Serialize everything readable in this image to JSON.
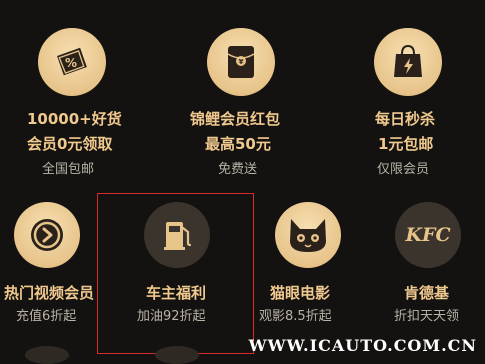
{
  "items": [
    {
      "title": "10000+好货",
      "line2": "会员0元领取",
      "subtitle": "全国包邮",
      "icon": "coupon-icon"
    },
    {
      "title": "锦鲤会员红包",
      "line2": "最高50元",
      "subtitle": "免费送",
      "icon": "red-envelope-icon"
    },
    {
      "title": "每日秒杀",
      "line2": "1元包邮",
      "subtitle": "仅限会员",
      "icon": "flash-sale-bag-icon"
    },
    {
      "title": "热门视频会员",
      "subtitle": "充值6折起",
      "icon": "video-play-icon"
    },
    {
      "title": "车主福利",
      "subtitle": "加油92折起",
      "icon": "fuel-pump-icon"
    },
    {
      "title": "猫眼电影",
      "subtitle": "观影8.5折起",
      "icon": "cat-face-icon"
    },
    {
      "title": "肯德基",
      "subtitle": "折扣天天领",
      "icon": "kfc-icon"
    }
  ],
  "kfc_logo_text": "KFC",
  "watermark": "WWW.ICAUTO.COM.CN",
  "colors": {
    "gold": "#e7c48a",
    "title": "#f0c98e",
    "subtitle": "#b9b2a6",
    "highlight": "#d62b2b"
  }
}
